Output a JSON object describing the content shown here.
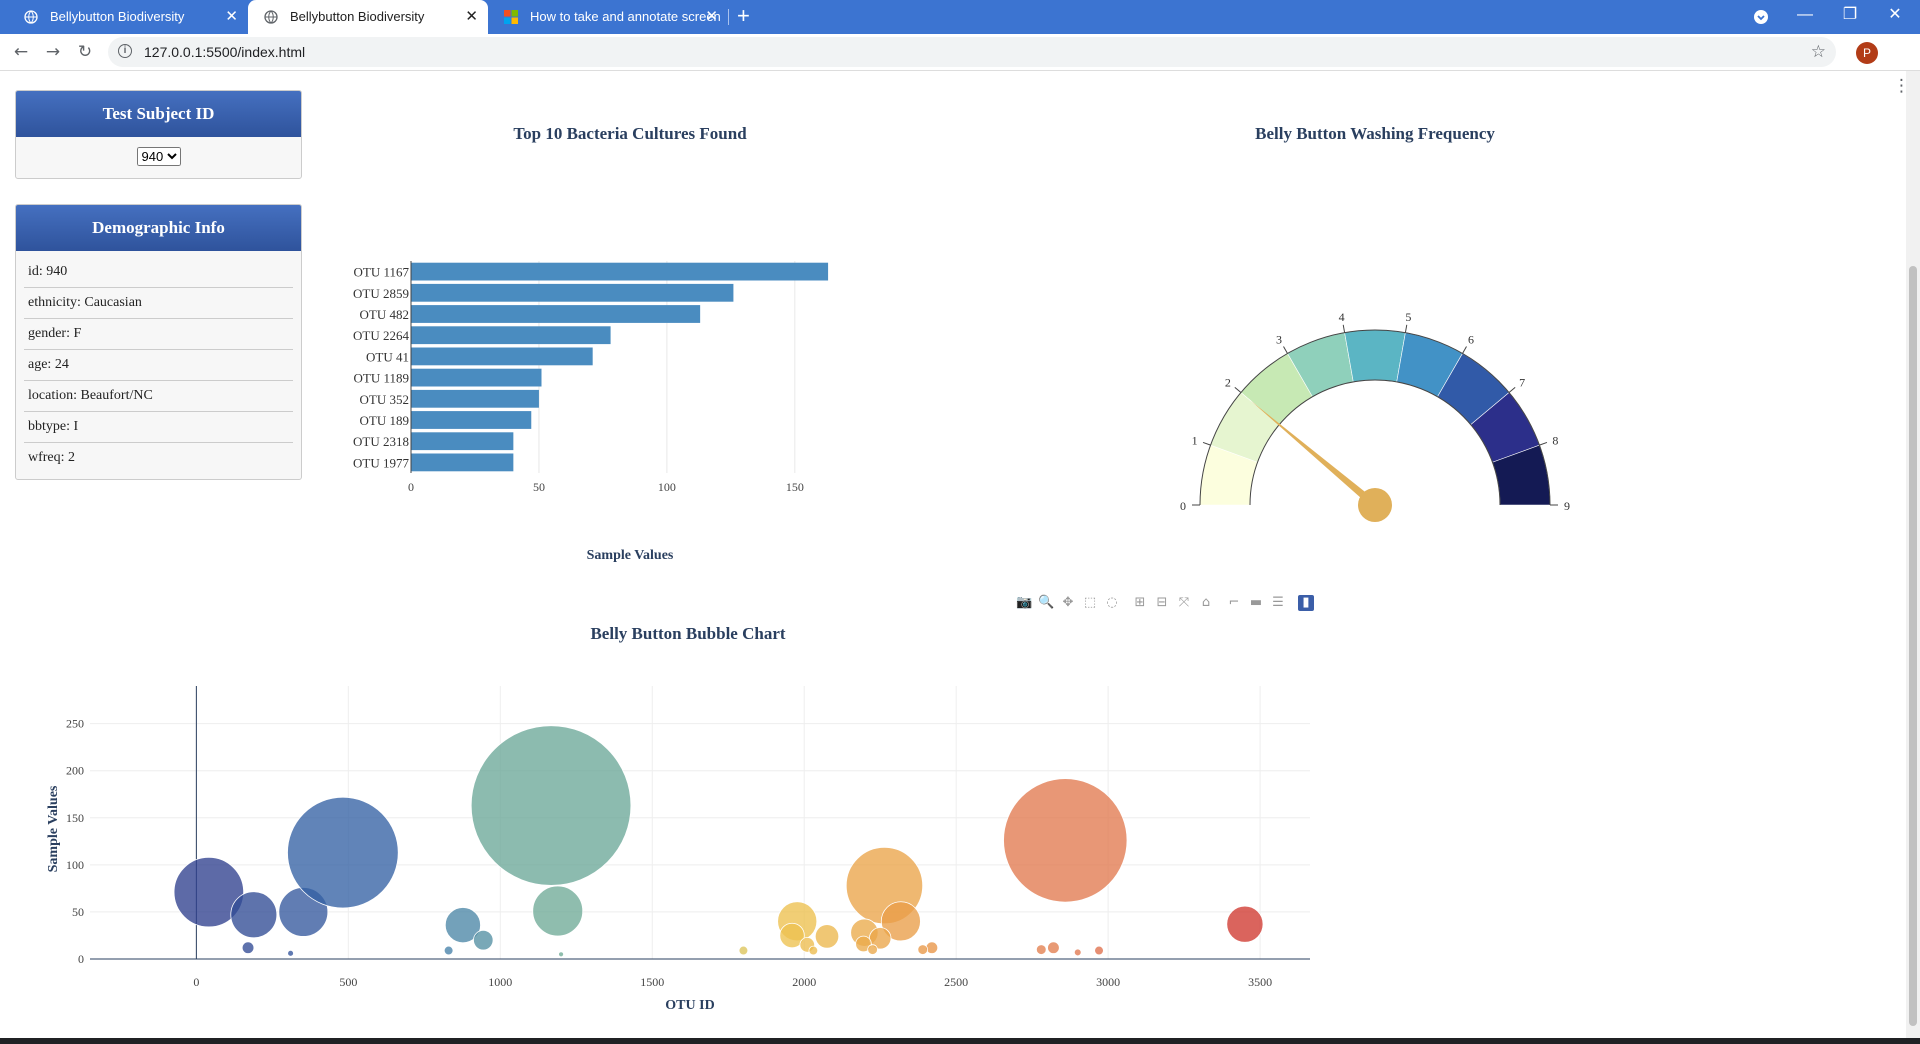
{
  "browser": {
    "tabs": [
      {
        "title": "Bellybutton Biodiversity",
        "active": false,
        "close": "✕"
      },
      {
        "title": "Bellybutton Biodiversity",
        "active": true,
        "close": "✕"
      },
      {
        "title": "How to take and annotate screen",
        "active": false,
        "close": "✕"
      }
    ],
    "new_tab": "+",
    "url": "127.0.0.1:5500/index.html",
    "avatar_letter": "P",
    "window_controls": {
      "minimize": "—",
      "restore": "❐",
      "close": "✕"
    }
  },
  "sidebar": {
    "subject_header": "Test Subject ID",
    "selected_id": "940",
    "demographic_header": "Demographic Info",
    "metadata": [
      "id: 940",
      "ethnicity: Caucasian",
      "gender: F",
      "age: 24",
      "location: Beaufort/NC",
      "bbtype: I",
      "wfreq: 2"
    ]
  },
  "colors": {
    "tab_bar": "#3c74d1",
    "panel_header": "#3b5ea8",
    "bar": "#4a8cc0",
    "title": "#2a3f5f",
    "gauge_needle": "#e0b05a"
  },
  "chart_data": [
    {
      "type": "bar",
      "orientation": "horizontal",
      "title": "Top 10 Bacteria Cultures Found",
      "xlabel": "Sample Values",
      "ylabel": "",
      "categories": [
        "OTU 1167",
        "OTU 2859",
        "OTU 482",
        "OTU 2264",
        "OTU 41",
        "OTU 1189",
        "OTU 352",
        "OTU 189",
        "OTU 2318",
        "OTU 1977"
      ],
      "values": [
        163,
        126,
        113,
        78,
        71,
        51,
        50,
        47,
        40,
        40
      ],
      "xticks": [
        0,
        50,
        100,
        150
      ],
      "xlim": [
        0,
        170
      ],
      "grid": true
    },
    {
      "type": "gauge",
      "title": "Belly Button Washing Frequency",
      "value": 2,
      "range": [
        0,
        9
      ],
      "tick_labels": [
        "0",
        "1",
        "2",
        "3",
        "4",
        "5",
        "6",
        "7",
        "8",
        "9"
      ],
      "step_colors": [
        "#fcfede",
        "#e6f5d0",
        "#c7e9b4",
        "#8fd0bb",
        "#5bb5c4",
        "#4292c6",
        "#315aa8",
        "#2c2f8a",
        "#141a54"
      ]
    },
    {
      "type": "scatter",
      "title": "Belly Button Bubble Chart",
      "xlabel": "OTU ID",
      "ylabel": "Sample Values",
      "xticks": [
        0,
        500,
        1000,
        1500,
        2000,
        2500,
        3000,
        3500
      ],
      "yticks": [
        0,
        50,
        100,
        150,
        200,
        250
      ],
      "xlim": [
        -350,
        3730
      ],
      "ylim": [
        0,
        290
      ],
      "points": [
        {
          "x": 41,
          "y": 71
        },
        {
          "x": 189,
          "y": 47
        },
        {
          "x": 352,
          "y": 50
        },
        {
          "x": 482,
          "y": 113
        },
        {
          "x": 877,
          "y": 36
        },
        {
          "x": 944,
          "y": 20
        },
        {
          "x": 1167,
          "y": 163
        },
        {
          "x": 1189,
          "y": 51
        },
        {
          "x": 1977,
          "y": 40
        },
        {
          "x": 1960,
          "y": 25
        },
        {
          "x": 2010,
          "y": 15
        },
        {
          "x": 2075,
          "y": 24
        },
        {
          "x": 2264,
          "y": 78
        },
        {
          "x": 2318,
          "y": 40
        },
        {
          "x": 2198,
          "y": 28
        },
        {
          "x": 2250,
          "y": 22
        },
        {
          "x": 2195,
          "y": 16
        },
        {
          "x": 2859,
          "y": 126
        },
        {
          "x": 3450,
          "y": 37
        },
        {
          "x": 170,
          "y": 12
        },
        {
          "x": 830,
          "y": 9
        },
        {
          "x": 1800,
          "y": 9
        },
        {
          "x": 2420,
          "y": 12
        },
        {
          "x": 2820,
          "y": 12
        },
        {
          "x": 2780,
          "y": 10
        },
        {
          "x": 2970,
          "y": 9
        },
        {
          "x": 2900,
          "y": 7
        },
        {
          "x": 2225,
          "y": 10
        },
        {
          "x": 2390,
          "y": 10
        },
        {
          "x": 2030,
          "y": 9
        },
        {
          "x": 310,
          "y": 6
        },
        {
          "x": 1200,
          "y": 5
        }
      ]
    }
  ]
}
